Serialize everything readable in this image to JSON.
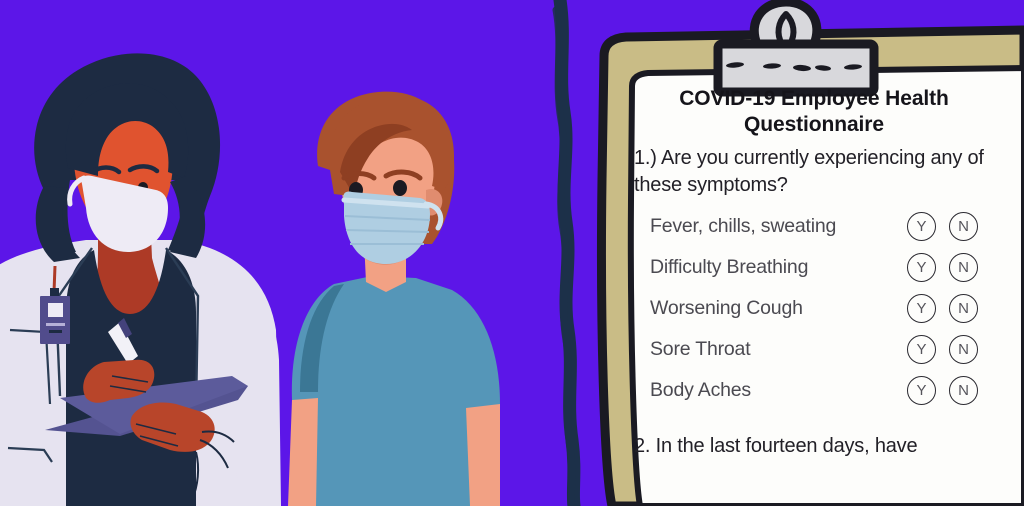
{
  "scene": {
    "background_color": "#5C16E8",
    "divider_color": "#1C3049",
    "alt_text": "Illustration of a masked doctor holding a clipboard standing beside a masked patient, next to a large COVID-19 employee health questionnaire on a clipboard"
  },
  "clipboard": {
    "board_color": "#C9BC86",
    "outline_color": "#1A1A22",
    "paper_color": "#FDFDFB",
    "clip": {
      "name": "clipboard-clip",
      "color": "#D8D8DC",
      "dash_count": 5
    }
  },
  "questionnaire": {
    "title": "COVID-19 Employee Health Questionnaire",
    "question1": "1.) Are you currently experiencing any of these symptoms?",
    "question2": "2. In the last fourteen days, have",
    "answer_yes": "Y",
    "answer_no": "N",
    "symptoms": [
      {
        "label": "Fever, chills, sweating"
      },
      {
        "label": "Difficulty Breathing"
      },
      {
        "label": "Worsening Cough"
      },
      {
        "label": "Sore Throat"
      },
      {
        "label": "Body Aches"
      }
    ]
  },
  "doctor": {
    "name": "doctor-figure",
    "hair_color": "#1D2B42",
    "skin_color": "#E0532F",
    "neck_color": "#AD3A26",
    "coat_color": "#E6E3F0",
    "mask_color": "#EEEBF5",
    "scrub_color": "#1D2B42",
    "badge_color": "#514C8C",
    "clipboard_color": "#545391",
    "pen_color": "#F2F1F7"
  },
  "patient": {
    "name": "patient-figure",
    "hair_color": "#A9522E",
    "hair_shadow_color": "#8E3F22",
    "skin_color": "#F2A184",
    "skin_shadow_color": "#E08C6F",
    "mask_color": "#AFCEE2",
    "mask_shadow_color": "#9BBED6",
    "shirt_color": "#5596B8",
    "shirt_shadow_color": "#3B7795"
  }
}
